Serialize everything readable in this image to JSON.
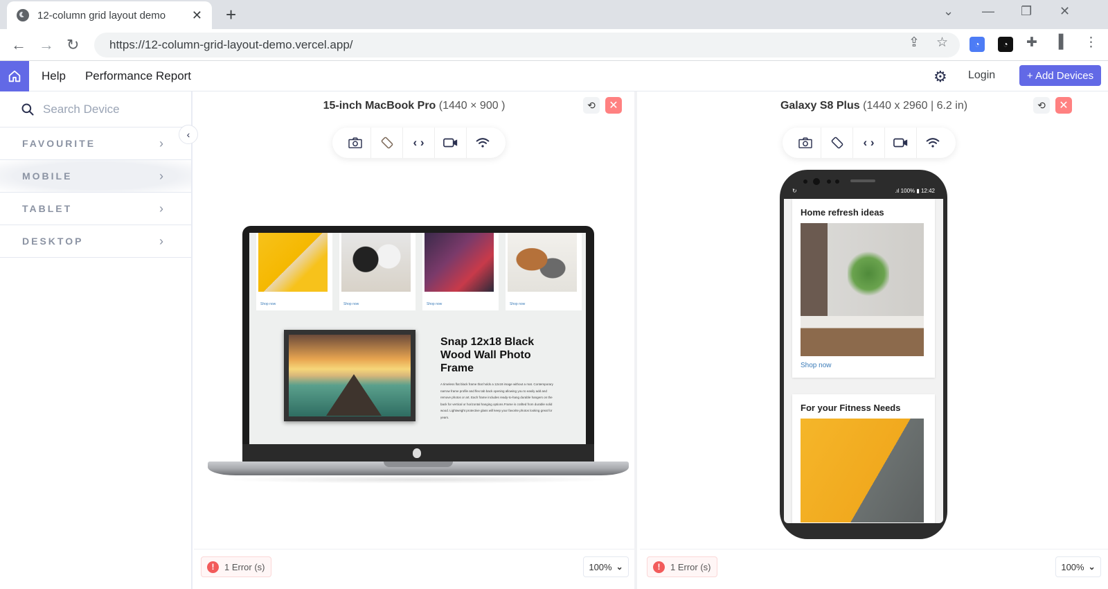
{
  "browser": {
    "tab_title": "12-column grid layout demo",
    "new_tab_label": "+",
    "url": "https://12-column-grid-layout-demo.vercel.app/",
    "icons": {
      "tab": "globe-icon",
      "back": "back-arrow-icon",
      "forward": "forward-arrow-icon",
      "reload": "reload-icon",
      "share": "share-icon",
      "bookmark": "star-icon",
      "extensions": "puzzle-icon",
      "side_panel": "side-panel-icon",
      "menu": "kebab-menu-icon"
    }
  },
  "appbar": {
    "home_icon": "home-icon",
    "links": [
      "Help",
      "Performance Report"
    ],
    "settings_icon": "gear-icon",
    "login_label": "Login",
    "add_devices_label": "+ Add Devices",
    "accent_color": "#6269e6"
  },
  "sidebar": {
    "search_placeholder": "Search Device",
    "categories": [
      {
        "label": "FAVOURITE",
        "active": false
      },
      {
        "label": "MOBILE",
        "active": true
      },
      {
        "label": "TABLET",
        "active": false
      },
      {
        "label": "DESKTOP",
        "active": false
      }
    ]
  },
  "panels": [
    {
      "device_name": "15-inch MacBook Pro",
      "device_dims": "(1440 × 900 )",
      "tools": [
        "camera-icon",
        "rotate-icon",
        "code-icon",
        "video-icon",
        "wifi-icon"
      ],
      "error_text": "1 Error (s)",
      "zoom": "100%",
      "preview": {
        "product_cards": [
          {
            "shop_label": "Shop now"
          },
          {
            "shop_label": "Shop now"
          },
          {
            "shop_label": "Shop now"
          },
          {
            "shop_label": "Shop now"
          }
        ],
        "feature_title": "Snap 12x18 Black Wood Wall Photo Frame",
        "feature_desc": "A timeless flat black frame that holds a 12x18 image without a mat. Contemporary narrow frame profile and flex tab back opening allowing you to easily add and remove photos or art. Each frame includes ready-to-hang durable hangers on the back for vertical or horizontal hanging options.Frame is crafted from durable solid wood. Lightweight protective glass will keep your favorite photos looking great for years."
      }
    },
    {
      "device_name": "Galaxy S8 Plus",
      "device_dims": "(1440 x 2960 | 6.2 in)",
      "tools": [
        "camera-icon",
        "rotate-icon",
        "code-icon",
        "video-icon",
        "wifi-icon"
      ],
      "error_text": "1 Error (s)",
      "zoom": "100%",
      "preview": {
        "status_battery": ".ıl 100% ▮ 12:42",
        "cards": [
          {
            "title": "Home refresh ideas",
            "shop_label": "Shop now"
          },
          {
            "title": "For your Fitness Needs"
          }
        ]
      }
    }
  ]
}
